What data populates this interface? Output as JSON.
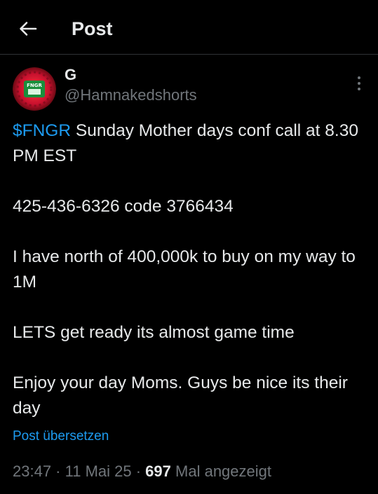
{
  "header": {
    "back_icon": "arrow-left-icon",
    "title": "Post"
  },
  "post": {
    "author": {
      "name": "G",
      "handle": "@Hamnakedshorts",
      "avatar_text": "FNGR",
      "avatar_colors": [
        "#c8102e",
        "#1a8f3c"
      ]
    },
    "more_icon": "more-vertical-icon",
    "cashtag": "$FNGR",
    "line1_rest": " Sunday Mother days conf call at 8.30 PM EST",
    "paragraphs": [
      "425-436-6326 code 3766434",
      "I have north of 400,000k to buy on my way to 1M",
      "LETS get ready its almost game time",
      "Enjoy your day Moms.    Guys be nice its their day"
    ],
    "translate_label": "Post übersetzen",
    "time": "23:47",
    "separator": " · ",
    "date": "11 Mai 25",
    "views_count": "697",
    "views_label": "Mal angezeigt"
  },
  "colors": {
    "background": "#000000",
    "text": "#e7e9ea",
    "muted": "#71767b",
    "accent": "#1d9bf0",
    "divider": "#2f3336"
  }
}
